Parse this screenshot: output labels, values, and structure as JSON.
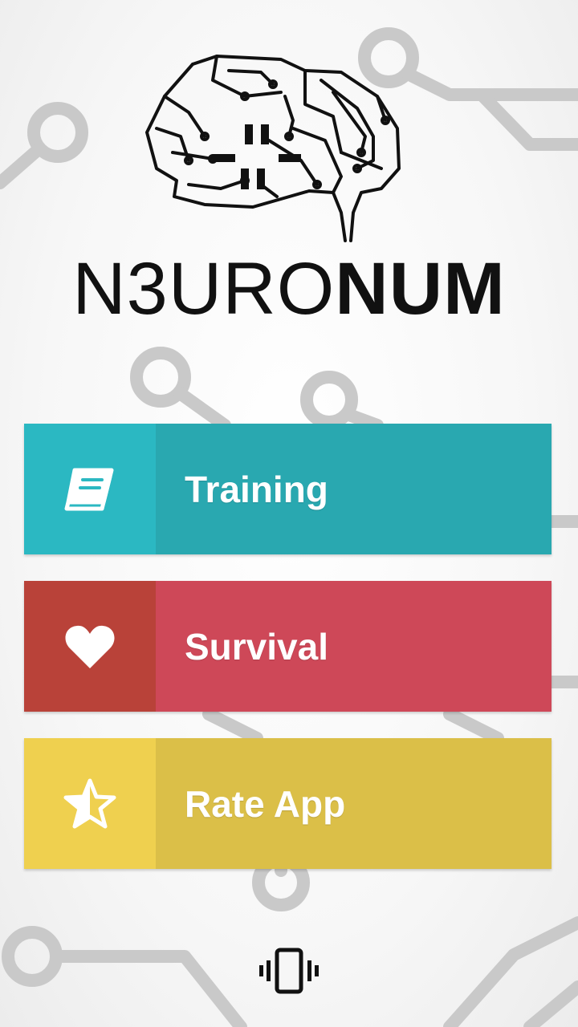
{
  "app": {
    "title_light": "N3URO",
    "title_bold": "NUM"
  },
  "menu": {
    "training": {
      "label": "Training",
      "icon": "book-icon",
      "color": "#29a8b0",
      "icon_bg": "#2bb8c2"
    },
    "survival": {
      "label": "Survival",
      "icon": "heart-icon",
      "color": "#ce4858",
      "icon_bg": "#b94239"
    },
    "rate": {
      "label": "Rate App",
      "icon": "half-star-icon",
      "color": "#dbbf48",
      "icon_bg": "#efd04f"
    }
  },
  "footer": {
    "vibrate_icon": "vibrate-icon"
  }
}
